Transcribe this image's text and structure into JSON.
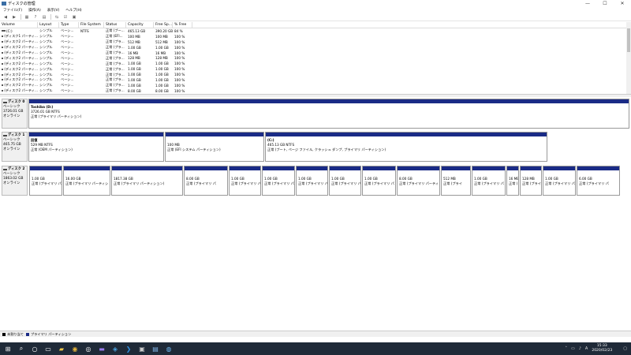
{
  "window": {
    "title": "ディスクの管理"
  },
  "menu": [
    "ファイル(F)",
    "操作(A)",
    "表示(V)",
    "ヘルプ(H)"
  ],
  "table": {
    "columns": [
      "Volume",
      "Layout",
      "Type",
      "File System",
      "Status",
      "Capacity",
      "Free Sp...",
      "% Free"
    ],
    "rows": [
      [
        "(C:)",
        "シンプル",
        "ベーシ...",
        "NTFS",
        "正常 (ブー...",
        "465.13 GB",
        "390.20 GB",
        "84 %"
      ],
      [
        "(ディスク1 パーティ...",
        "シンプル",
        "ベーシ...",
        "",
        "正常 (EFI...",
        "100 MB",
        "100 MB",
        "100 %"
      ],
      [
        "(ディスク2 パーティ...",
        "シンプル",
        "ベーシ...",
        "",
        "正常 (プラ...",
        "512 MB",
        "512 MB",
        "100 %"
      ],
      [
        "(ディスク2 パーティ...",
        "シンプル",
        "ベーシ...",
        "",
        "正常 (プラ...",
        "1.00 GB",
        "1.00 GB",
        "100 %"
      ],
      [
        "(ディスク2 パーティ...",
        "シンプル",
        "ベーシ...",
        "",
        "正常 (プラ...",
        "16 MB",
        "16 MB",
        "100 %"
      ],
      [
        "(ディスク2 パーティ...",
        "シンプル",
        "ベーシ...",
        "",
        "正常 (プラ...",
        "128 MB",
        "128 MB",
        "100 %"
      ],
      [
        "(ディスク2 パーティ...",
        "シンプル",
        "ベーシ...",
        "",
        "正常 (プラ...",
        "1.00 GB",
        "1.00 GB",
        "100 %"
      ],
      [
        "(ディスク2 パーティ...",
        "シンプル",
        "ベーシ...",
        "",
        "正常 (プラ...",
        "1.00 GB",
        "1.00 GB",
        "100 %"
      ],
      [
        "(ディスク2 パーティ...",
        "シンプル",
        "ベーシ...",
        "",
        "正常 (プラ...",
        "1.00 GB",
        "1.00 GB",
        "100 %"
      ],
      [
        "(ディスク2 パーティ...",
        "シンプル",
        "ベーシ...",
        "",
        "正常 (プラ...",
        "1.00 GB",
        "1.00 GB",
        "100 %"
      ],
      [
        "(ディスク2 パーティ...",
        "シンプル",
        "ベーシ...",
        "",
        "正常 (プラ...",
        "1.00 GB",
        "1.00 GB",
        "100 %"
      ],
      [
        "(ディスク2 パーティ...",
        "シンプル",
        "ベーシ...",
        "",
        "正常 (プラ...",
        "8.00 GB",
        "8.00 GB",
        "100 %"
      ],
      [
        "(ディスク2 パーティ...",
        "シンプル",
        "ベーシ...",
        "",
        "正常 (プラ...",
        "1.00 GB",
        "1.00 GB",
        "100 %"
      ]
    ]
  },
  "disks": [
    {
      "name": "ディスク 0",
      "type": "ベーシック",
      "size": "3726.01 GB",
      "state": "オンライン",
      "partitions": [
        {
          "name": "Toshiba (D:)",
          "size": "3726.01 GB NTFS",
          "status": "正常 (プライマリ パーティション)"
        }
      ]
    },
    {
      "name": "ディスク 1",
      "type": "ベーシック",
      "size": "465.75 GB",
      "state": "オンライン",
      "partitions": [
        {
          "name": "回復",
          "size": "529 MB NTFS",
          "status": "正常 (OEM パーティション)"
        },
        {
          "name": "",
          "size": "100 MB",
          "status": "正常 (EFI システム パーティション)"
        },
        {
          "name": "(C:)",
          "size": "465.13 GB NTFS",
          "status": "正常 (ブート, ページ ファイル, クラッシュ ダンプ, プライマリ パーティション)"
        }
      ]
    },
    {
      "name": "ディスク 2",
      "type": "ベーシック",
      "size": "1863.02 GB",
      "state": "オンライン",
      "partitions": [
        {
          "size": "1.00 GB",
          "status": "正常 (プライマリ パ"
        },
        {
          "size": "16.00 GB",
          "status": "正常 (プライマリ パーティシ"
        },
        {
          "size": "1817.38 GB",
          "status": "正常 (プライマリ パーティション)"
        },
        {
          "size": "8.00 GB",
          "status": "正常 (プライマリ パ"
        },
        {
          "size": "1.00 GB",
          "status": "正常 (プライマリ パ"
        },
        {
          "size": "1.00 GB",
          "status": "正常 (プライマリ パ"
        },
        {
          "size": "1.00 GB",
          "status": "正常 (プライマリ パ"
        },
        {
          "size": "1.00 GB",
          "status": "正常 (プライマリ パ"
        },
        {
          "size": "1.00 GB",
          "status": "正常 (プライマリ パ"
        },
        {
          "size": "8.00 GB",
          "status": "正常 (プライマリ パーティ"
        },
        {
          "size": "512 MB",
          "status": "正常 (プライ"
        },
        {
          "size": "1.00 GB",
          "status": "正常 (プライマリ パ"
        },
        {
          "size": "16 MB",
          "status": "正常 ("
        },
        {
          "size": "128 MB",
          "status": "正常 (プライ"
        },
        {
          "size": "1.00 GB",
          "status": "正常 (プライマリ パ"
        },
        {
          "size": "6.00 GB",
          "status": "正常 (プライマリ パ"
        }
      ]
    }
  ],
  "legend": [
    "未割り当て",
    "プライマリ パーティション"
  ],
  "colors": {
    "partition_bar": "#1a2b86",
    "unallocated": "#000000",
    "taskbar": "#1f2a38"
  },
  "taskbar": {
    "icons": [
      "windows-icon",
      "search-icon",
      "task-view-icon",
      "explorer-icon",
      "chrome-icon",
      "app-icon",
      "app-icon",
      "app-icon",
      "vscode-icon",
      "terminal-icon",
      "disk-management-icon",
      "app-icon"
    ],
    "time": "15:33",
    "date": "2020/02/23"
  }
}
